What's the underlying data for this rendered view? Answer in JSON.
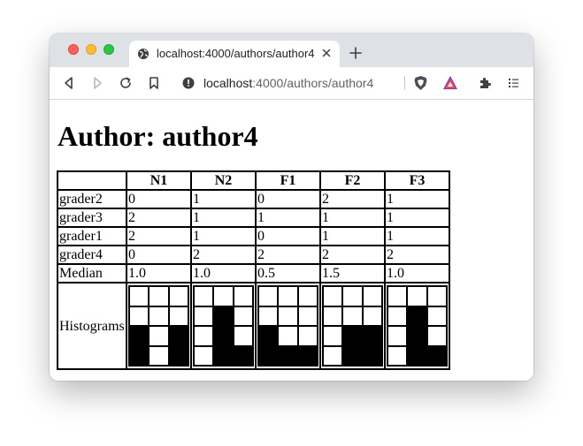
{
  "browser": {
    "tab_title": "localhost:4000/authors/author4",
    "url_host": "localhost",
    "url_path": ":4000/authors/author4"
  },
  "page": {
    "heading": "Author: author4"
  },
  "table": {
    "columns": [
      "",
      "N1",
      "N2",
      "F1",
      "F2",
      "F3"
    ],
    "rows": [
      {
        "label": "grader2",
        "values": [
          "0",
          "1",
          "0",
          "2",
          "1"
        ]
      },
      {
        "label": "grader3",
        "values": [
          "2",
          "1",
          "1",
          "1",
          "1"
        ]
      },
      {
        "label": "grader1",
        "values": [
          "2",
          "1",
          "0",
          "1",
          "1"
        ]
      },
      {
        "label": "grader4",
        "values": [
          "0",
          "2",
          "2",
          "2",
          "2"
        ]
      },
      {
        "label": "Median",
        "values": [
          "1.0",
          "1.0",
          "0.5",
          "1.5",
          "1.0"
        ]
      }
    ],
    "histogram_label": "Histograms",
    "histograms": [
      {
        "column": "N1",
        "counts": [
          2,
          0,
          2
        ]
      },
      {
        "column": "N2",
        "counts": [
          0,
          3,
          1
        ]
      },
      {
        "column": "F1",
        "counts": [
          2,
          1,
          1
        ]
      },
      {
        "column": "F2",
        "counts": [
          0,
          2,
          2
        ]
      },
      {
        "column": "F3",
        "counts": [
          0,
          3,
          1
        ]
      }
    ],
    "histogram_max": 4
  }
}
